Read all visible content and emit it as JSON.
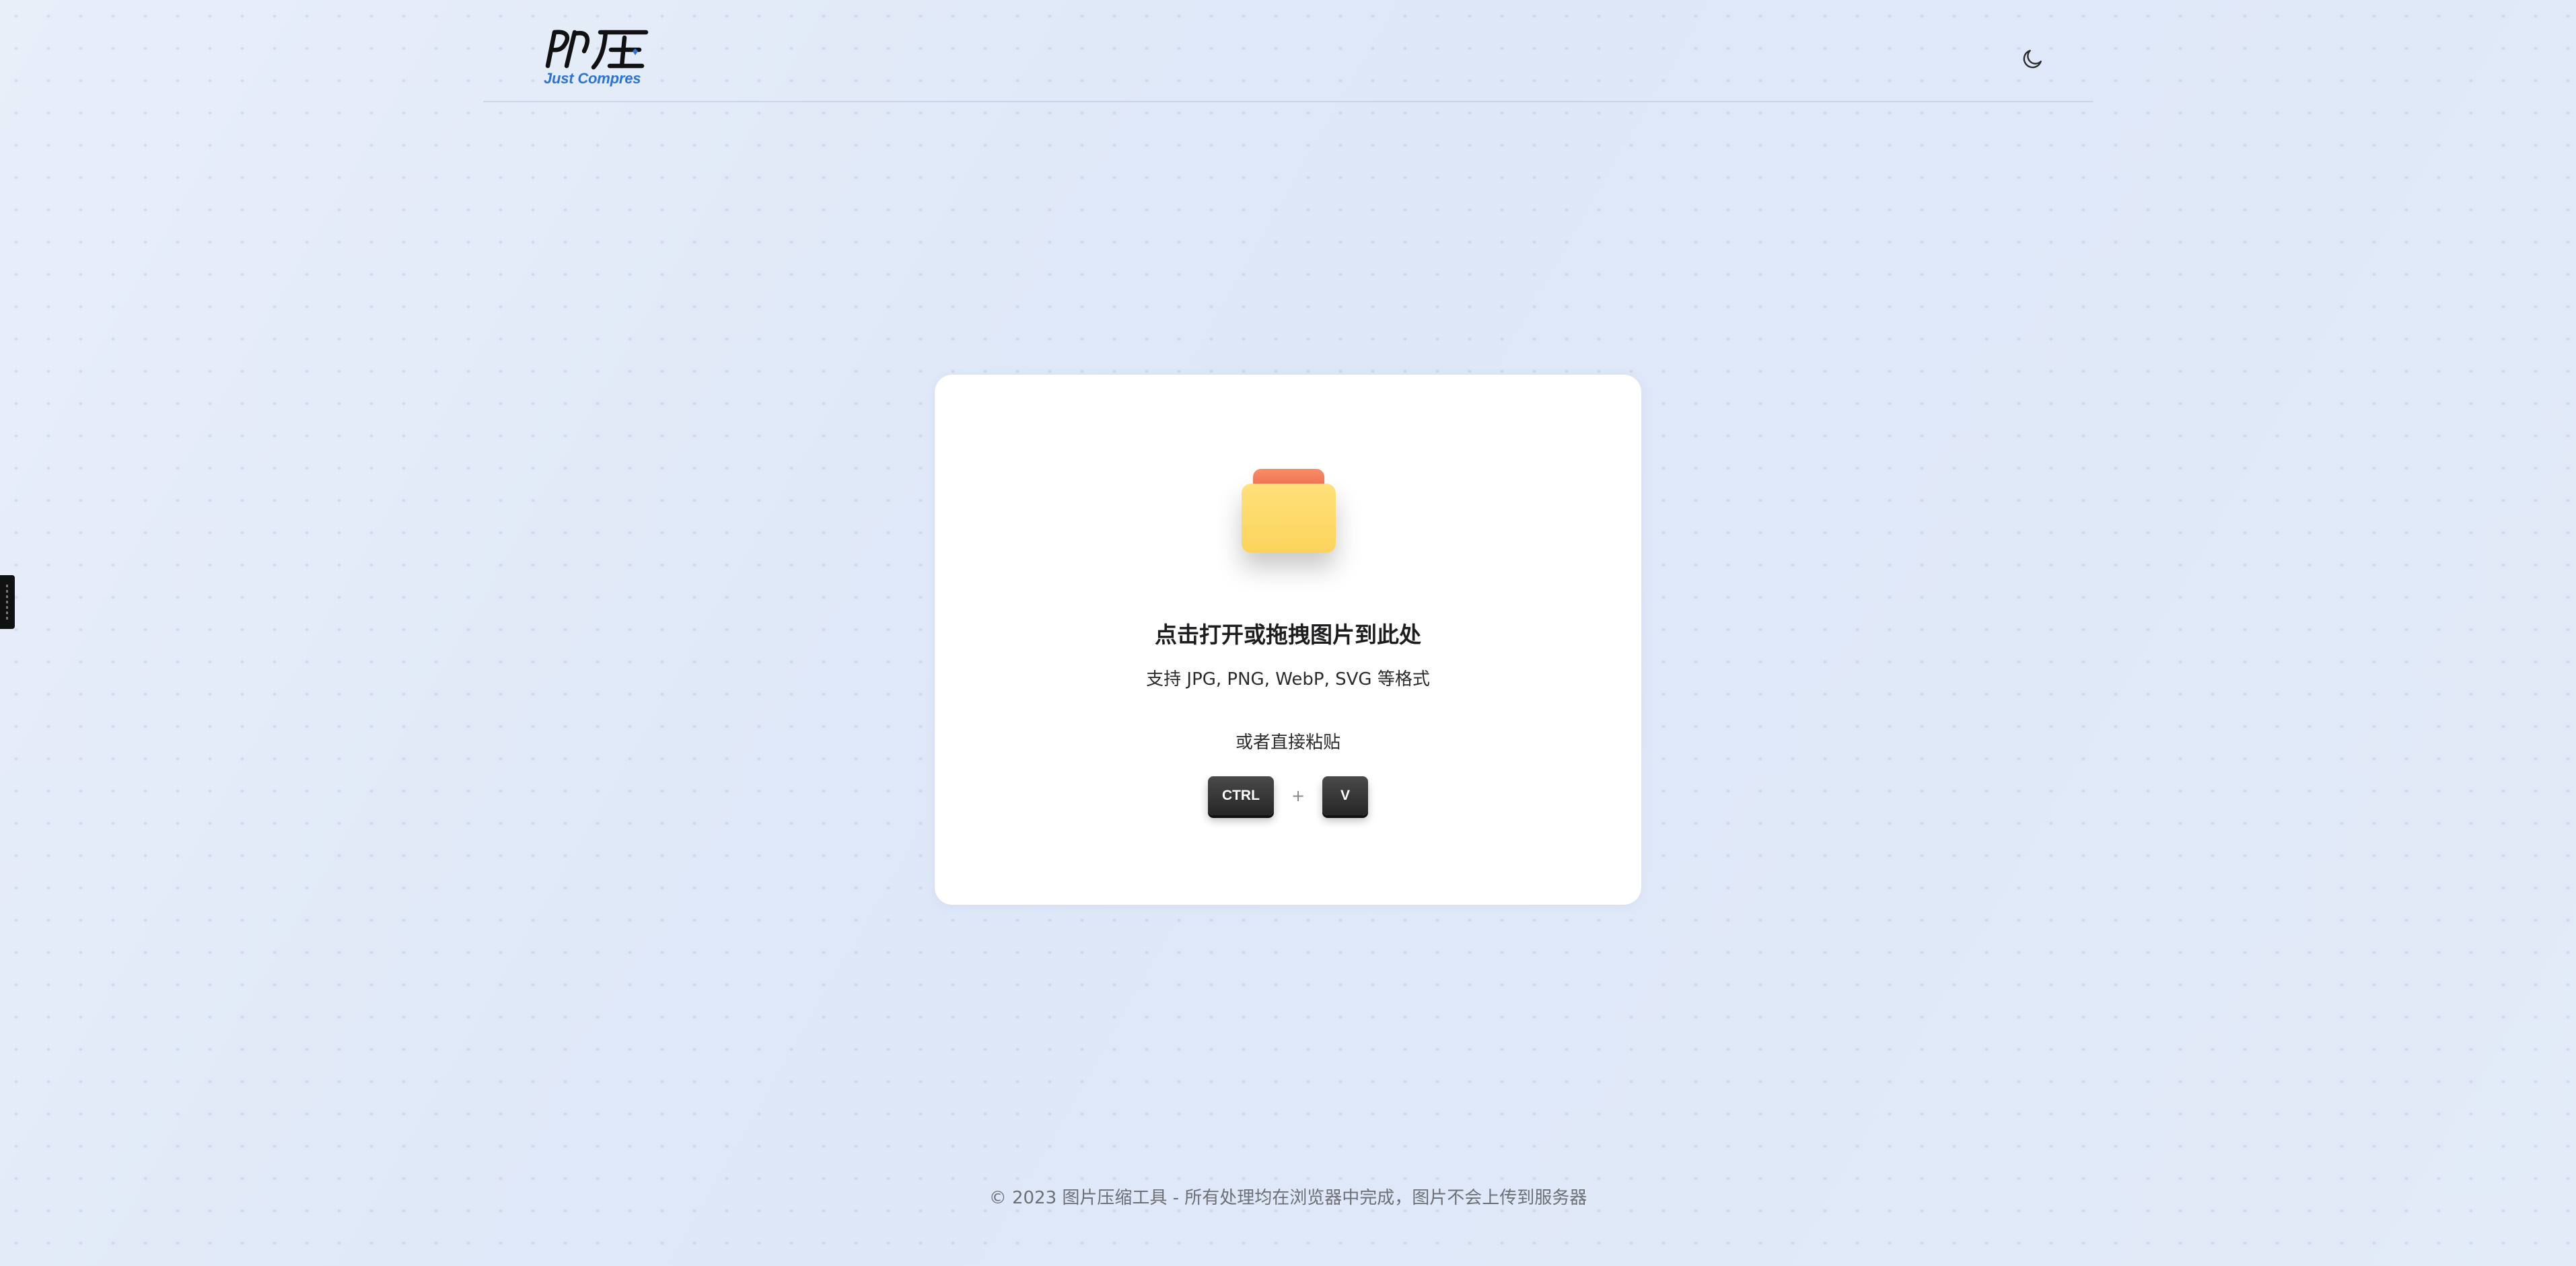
{
  "header": {
    "logo_alt": "即压",
    "logo_subtitle": "Just Compres",
    "theme_toggle_icon": "moon-icon"
  },
  "upload": {
    "icon": "folder-icon",
    "title": "点击打开或拖拽图片到此处",
    "formats": "支持 JPG, PNG, WebP, SVG 等格式",
    "paste_hint": "或者直接粘贴",
    "key_ctrl": "CTRL",
    "key_plus": "+",
    "key_v": "V"
  },
  "footer": {
    "text": "© 2023 图片压缩工具 - 所有处理均在浏览器中完成，图片不会上传到服务器"
  },
  "colors": {
    "background": "#e5ecf8",
    "accent": "#2b73d6",
    "folder_tab": "#f98c64",
    "folder_body": "#fbd45c",
    "key": "#2f2f2f"
  }
}
